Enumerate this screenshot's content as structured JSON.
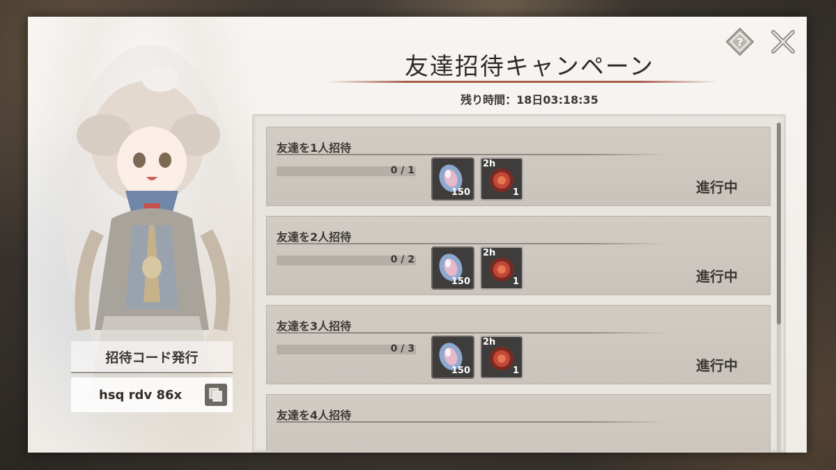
{
  "dialog": {
    "title": "友達招待キャンペーン",
    "timer": "残り時間：18日03:18:35"
  },
  "invite_code": {
    "heading": "招待コード発行",
    "code": "hsq rdv 86x"
  },
  "missions": [
    {
      "label": "友達を1人招待",
      "progress_text": "0 / 1",
      "progress": 0,
      "status": "進行中",
      "rewards": [
        {
          "icon": "gem-icon",
          "qty": "150"
        },
        {
          "icon": "orb-icon",
          "tag": "2h",
          "qty": "1"
        }
      ]
    },
    {
      "label": "友達を2人招待",
      "progress_text": "0 / 2",
      "progress": 0,
      "status": "進行中",
      "rewards": [
        {
          "icon": "gem-icon",
          "qty": "150"
        },
        {
          "icon": "orb-icon",
          "tag": "2h",
          "qty": "1"
        }
      ]
    },
    {
      "label": "友達を3人招待",
      "progress_text": "0 / 3",
      "progress": 0,
      "status": "進行中",
      "rewards": [
        {
          "icon": "gem-icon",
          "qty": "150"
        },
        {
          "icon": "orb-icon",
          "tag": "2h",
          "qty": "1"
        }
      ]
    },
    {
      "label": "友達を4人招待"
    }
  ],
  "colors": {
    "accent_line": "#a85a4a",
    "panel_bg": "#f7f5f2",
    "row_bg": "#d2ccc5",
    "text": "#3a3632"
  }
}
